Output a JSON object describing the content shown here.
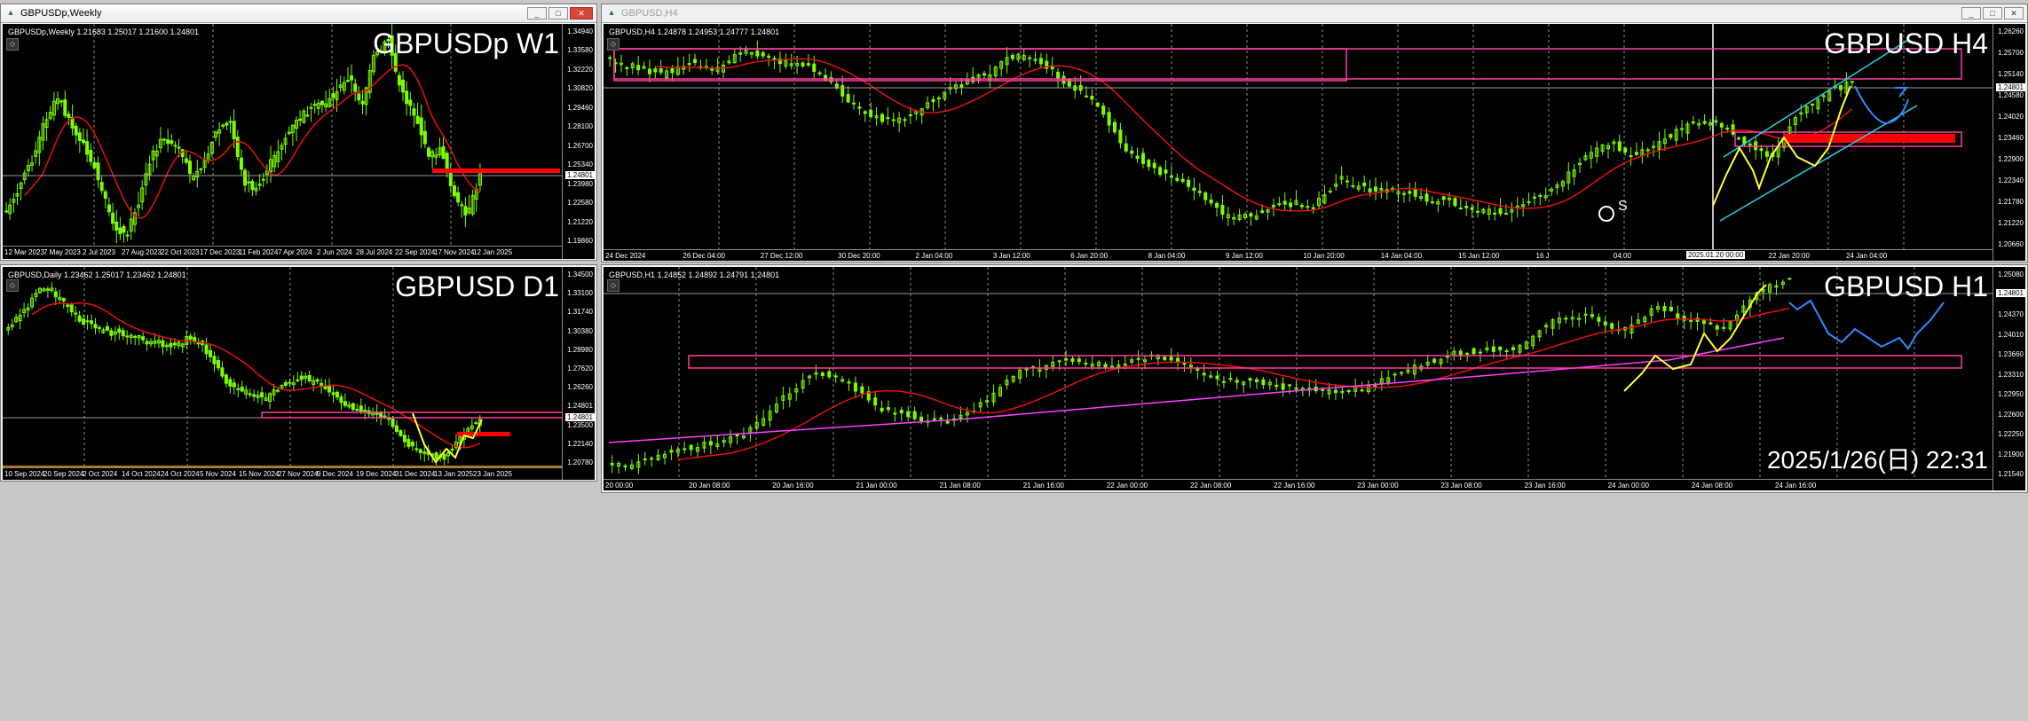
{
  "windows": {
    "w1": {
      "title": "GBPUSDp,Weekly",
      "info": "GBPUSDp,Weekly  1.21683 1.25017 1.21600 1.24801",
      "label": "GBPUSDp W1",
      "yaxis": [
        "1.34940",
        "1.33580",
        "1.32220",
        "1.30820",
        "1.29460",
        "1.28100",
        "1.26700",
        "1.25340",
        "1.23980",
        "1.22580",
        "1.21220",
        "1.19860"
      ],
      "price_tag": "1.24801",
      "xaxis": [
        "12 Mar 2023",
        "7 May 2023",
        "2 Jul 2023",
        "27 Aug 2023",
        "22 Oct 2023",
        "17 Dec 2023",
        "11 Feb 2024",
        "7 Apr 2024",
        "2 Jun 2024",
        "28 Jul 2024",
        "22 Sep 2024",
        "17 Nov 2024",
        "12 Jan 2025"
      ]
    },
    "h4": {
      "title": "GBPUSD,H4",
      "info": "GBPUSD,H4  1.24878 1.24953 1.24777 1.24801",
      "label": "GBPUSD H4",
      "yaxis": [
        "1.26260",
        "1.25700",
        "1.25140",
        "1.24580",
        "1.24020",
        "1.23460",
        "1.22900",
        "1.22340",
        "1.21780",
        "1.21220",
        "1.20660"
      ],
      "price_tag": "1.24801",
      "xaxis": [
        "24 Dec 2024",
        "26 Dec 04:00",
        "27 Dec 12:00",
        "30 Dec 20:00",
        "2 Jan 04:00",
        "3 Jan 12:00",
        "6 Jan 20:00",
        "8 Jan 04:00",
        "9 Jan 12:00",
        "10 Jan 20:00",
        "14 Jan 04:00",
        "15 Jan 12:00",
        "16 J",
        "04:00",
        "21 Jan 12:00",
        "22 Jan 20:00",
        "24 Jan 04:00"
      ],
      "cursor_time": "2025.01.20 00:00",
      "annotation": "S"
    },
    "d1": {
      "title": "GBPUSD,Daily",
      "info": "GBPUSD,Daily  1.23462 1.25017 1.23462 1.24801",
      "label": "GBPUSD D1",
      "yaxis": [
        "1.34500",
        "1.33100",
        "1.31740",
        "1.30380",
        "1.28980",
        "1.27620",
        "1.26260",
        "1.24801",
        "1.23500",
        "1.22140",
        "1.20780"
      ],
      "price_tag": "1.24801",
      "xaxis": [
        "10 Sep 2024",
        "20 Sep 2024",
        "2 Oct 2024",
        "14 Oct 2024",
        "24 Oct 2024",
        "5 Nov 2024",
        "15 Nov 2024",
        "27 Nov 2024",
        "9 Dec 2024",
        "19 Dec 2024",
        "31 Dec 2024",
        "13 Jan 2025",
        "23 Jan 2025"
      ]
    },
    "h1": {
      "title": "GBPUSD,H1",
      "info": "GBPUSD,H1  1.24852 1.24892 1.24791 1.24801",
      "label": "GBPUSD H1",
      "yaxis": [
        "1.25080",
        "1.24720",
        "1.24370",
        "1.24010",
        "1.23660",
        "1.23310",
        "1.22950",
        "1.22600",
        "1.22250",
        "1.21900",
        "1.21540"
      ],
      "price_tag": "1.24801",
      "xaxis": [
        "20 00:00",
        "20 Jan 08:00",
        "20 Jan 16:00",
        "21 Jan 00:00",
        "21 Jan 08:00",
        "21 Jan 16:00",
        "22 Jan 00:00",
        "22 Jan 08:00",
        "22 Jan 16:00",
        "23 Jan 00:00",
        "23 Jan 08:00",
        "23 Jan 16:00",
        "24 Jan 00:00",
        "24 Jan 08:00",
        "24 Jan 16:00"
      ],
      "timestamp": "2025/1/26(日) 22:31"
    }
  },
  "colors": {
    "candle": "#7cfc00",
    "ma_red": "#e81010",
    "ma_magenta": "#ff40ff",
    "zone_magenta": "#ff3ca0",
    "zone_red": "#ff0000",
    "trend_yellow": "#ffff33",
    "channel_cyan": "#22d3e8",
    "forecast_blue": "#2e8bff",
    "grid": "#8a8a8a"
  },
  "window_buttons": {
    "minimize": "_",
    "restore": "□",
    "close": "✕"
  }
}
